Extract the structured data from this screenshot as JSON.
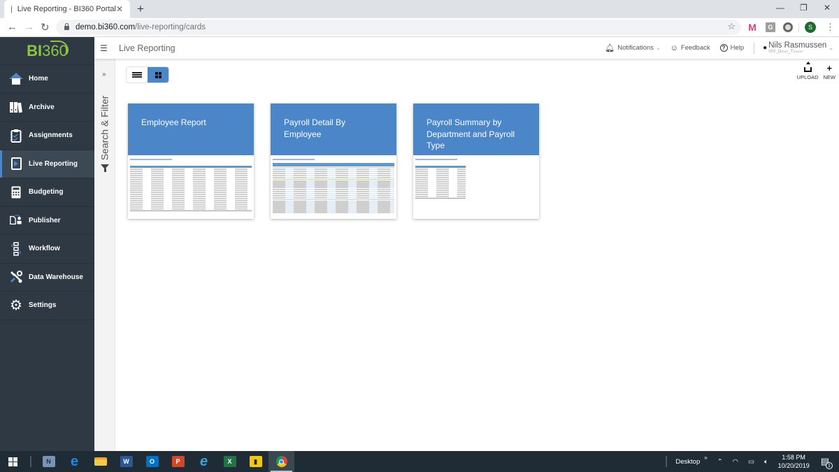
{
  "browser": {
    "tab_title": "Live Reporting - BI360 Portal",
    "url_host": "demo.bi360.com",
    "url_path": "/live-reporting/cards",
    "profile_initial": "S"
  },
  "app": {
    "logo_bi": "BI",
    "logo_num": "360",
    "page_title": "Live Reporting",
    "header": {
      "notifications": "Notifications",
      "feedback": "Feedback",
      "help": "Help",
      "user_name": "Nils Rasmussen",
      "tenant": "ISV_Demo_Tenant"
    },
    "sidebar": {
      "items": [
        {
          "label": "Home",
          "icon": "home-icon"
        },
        {
          "label": "Archive",
          "icon": "archive-icon"
        },
        {
          "label": "Assignments",
          "icon": "clipboard-icon"
        },
        {
          "label": "Live Reporting",
          "icon": "live-reporting-icon",
          "active": true
        },
        {
          "label": "Budgeting",
          "icon": "calculator-icon"
        },
        {
          "label": "Publisher",
          "icon": "publisher-icon"
        },
        {
          "label": "Workflow",
          "icon": "workflow-icon"
        },
        {
          "label": "Data Warehouse",
          "icon": "tools-icon"
        },
        {
          "label": "Settings",
          "icon": "gear-icon"
        }
      ]
    },
    "filter_panel": {
      "label": "Search & Filter"
    },
    "toolbar": {
      "view_mode": "cards",
      "upload_label": "UPLOAD",
      "new_label": "NEW"
    },
    "cards": [
      {
        "title": "Employee Report"
      },
      {
        "title": "Payroll Detail By Employee"
      },
      {
        "title": "Payroll Summary by Department and Payroll Type"
      }
    ]
  },
  "taskbar": {
    "apps": [
      "start",
      "task-view",
      "notepad-app",
      "edge",
      "file-explorer",
      "word",
      "outlook",
      "powerpoint",
      "internet-explorer",
      "excel",
      "power-bi",
      "chrome"
    ],
    "desktop_label": "Desktop",
    "time": "1:58 PM",
    "date": "10/20/2019",
    "notification_count": "1"
  },
  "colors": {
    "accent": "#4a86c8",
    "sidebar_bg": "#2f3944",
    "logo_green": "#8dc63f"
  }
}
